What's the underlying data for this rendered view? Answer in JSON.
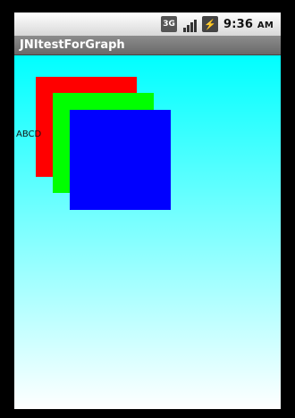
{
  "status_bar": {
    "network_label": "3G",
    "time": "9:36",
    "am_pm": "AM",
    "icons": [
      "network-3g-icon",
      "signal-icon",
      "battery-icon"
    ]
  },
  "title_bar": {
    "title": "JNItestForGraph"
  },
  "canvas": {
    "text_label": "ABCD",
    "squares": [
      {
        "name": "red-square",
        "color": "#ff0000"
      },
      {
        "name": "green-square",
        "color": "#00ff00"
      },
      {
        "name": "blue-square",
        "color": "#0000ff"
      }
    ],
    "background_top": "#00ffff",
    "background_bottom": "#ffffff"
  }
}
